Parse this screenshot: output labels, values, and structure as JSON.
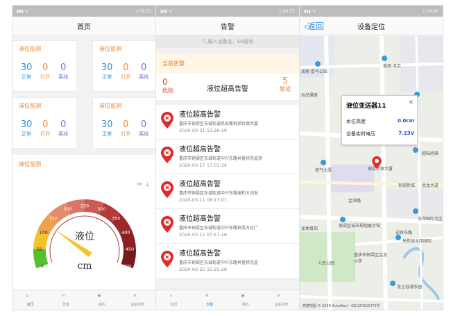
{
  "status": {
    "s1_time": "1:09:53",
    "s2_time": "1:09:53",
    "s3_time": "1:14:07"
  },
  "home": {
    "title": "首页",
    "cards": [
      {
        "title": "液位监测",
        "normal": "30",
        "open": "0",
        "offline": "0"
      },
      {
        "title": "液位监测",
        "normal": "30",
        "open": "0",
        "offline": "0"
      },
      {
        "title": "液位监测",
        "normal": "30",
        "open": "0",
        "offline": "0"
      },
      {
        "title": "液位监测",
        "normal": "30",
        "open": "0",
        "offline": "0"
      }
    ],
    "stat_labels": {
      "normal": "正常",
      "open": "打开",
      "offline": "离线"
    },
    "gauge": {
      "title": "液位监测",
      "center_label": "液位",
      "unit": "cm",
      "ticks": [
        "0",
        "50",
        "100",
        "150",
        "200",
        "250",
        "300",
        "350",
        "400",
        "450",
        "500"
      ],
      "value": 125,
      "max": 500
    }
  },
  "alarm": {
    "title": "告警",
    "search_placeholder": "输入设备名、SN查询",
    "current_label": "当前告警",
    "danger_count": "0",
    "danger_label": "危险",
    "summary_title": "液位超高告警",
    "warn_count": "5",
    "warn_label": "警戒",
    "items": [
      {
        "title": "液位超高告警",
        "address": "重庆市铜梁区东城街道民安路铜梁社保大厦",
        "time": "2020-03-31 13:26:19"
      },
      {
        "title": "液位超高告警",
        "address": "重庆市铜梁区东城街道中兴东路井盖状态监测",
        "time": "2020-03-27 17:01:24"
      },
      {
        "title": "液位超高告警",
        "address": "重庆市铜梁区东城街道中兴东路逸和大润发",
        "time": "2020-03-11 08:13:07"
      },
      {
        "title": "液位超高告警",
        "address": "重庆市铜梁区东城街道中兴东路铜梁万达广",
        "time": "2020-03-11 07:57:16"
      },
      {
        "title": "液位超高告警",
        "address": "重庆市铜梁区东城街道中兴东路井盖状态监",
        "time": "2020-02-25 15:25:29"
      }
    ]
  },
  "location": {
    "back_label": "返回",
    "title": "设备定位",
    "popup": {
      "title": "液位变送器11",
      "level_label": "水位高度",
      "level_value": "0.0cm",
      "voltage_label": "设备实时电压",
      "voltage_value": "7.23V"
    },
    "map_labels": [
      "润期·壹号公馆",
      "美丽·泽京",
      "尚品雅居",
      "欧陆经典",
      "燃气大厦",
      "铜梁社保大厦",
      "铜梁新城",
      "水岸国际北区",
      "金滨路",
      "铜梁区城市规划展示馆",
      "龙体育馆",
      "重庆市铜梁区金龙小学",
      "迎宾东路",
      "来新居水岸国际",
      "人民公园",
      "龙之谷游乐园",
      "金龙大道"
    ],
    "attribution": "高德地图 © 2020 AutoNavi - GS(2019)6379号"
  },
  "tabs": [
    "首页",
    "告警",
    "我的",
    "设备列表"
  ],
  "colors": {
    "accent": "#2b8cd6",
    "orange": "#e67e22",
    "danger": "#e23a2b"
  }
}
